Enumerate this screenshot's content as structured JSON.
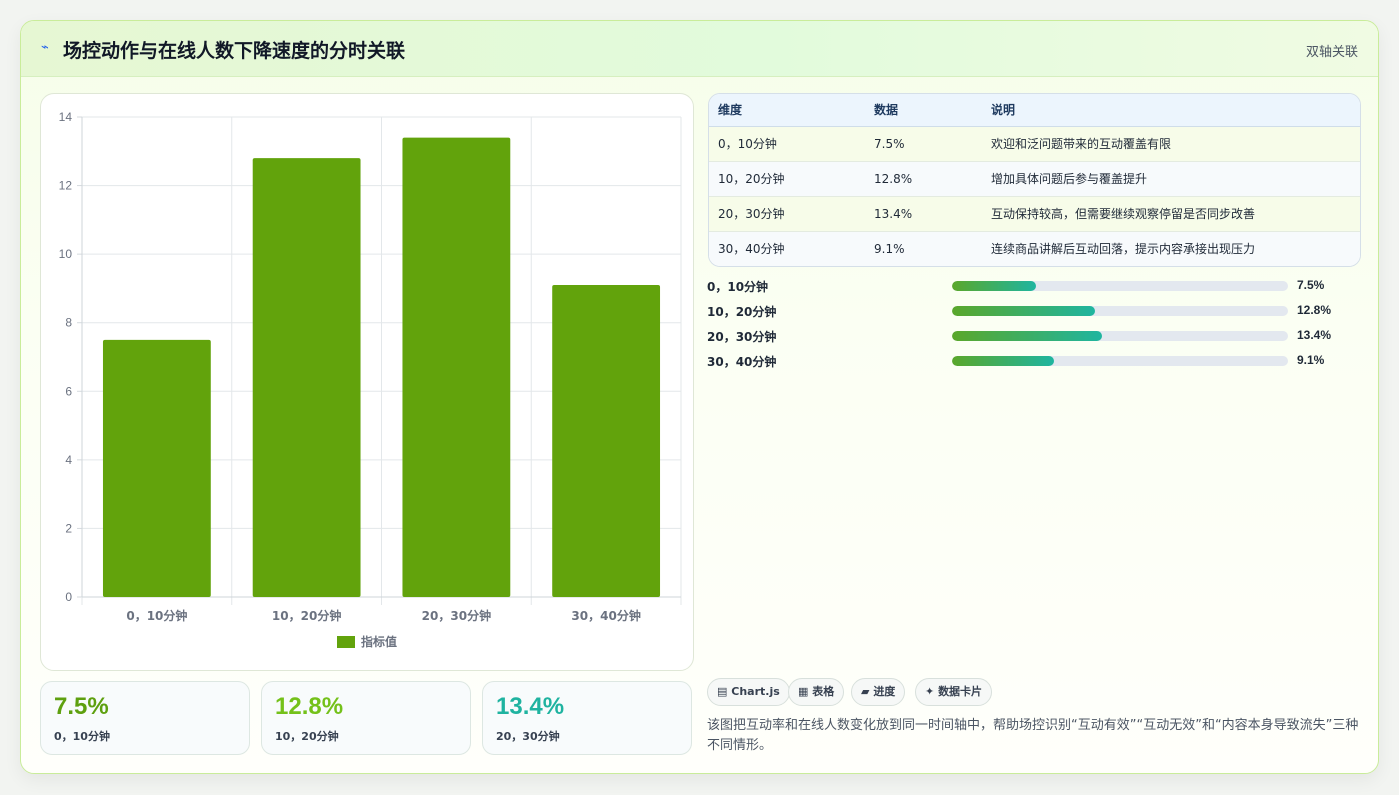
{
  "header": {
    "icon": "chart-spark-icon",
    "title": "场控动作与在线人数下降速度的分时关联",
    "tag": "双轴关联"
  },
  "colors": {
    "bar": "#62a30c",
    "stat1": "#5ea00f",
    "stat2": "#74c11a",
    "stat3": "#1fb3a0",
    "accent": "#1fb5a0"
  },
  "chart_data": {
    "type": "bar",
    "categories": [
      "0，10分钟",
      "10，20分钟",
      "20，30分钟",
      "30，40分钟"
    ],
    "series": [
      {
        "name": "指标值",
        "values": [
          7.5,
          12.8,
          13.4,
          9.1
        ]
      }
    ],
    "ylim": [
      0,
      14
    ],
    "yticks": [
      "0",
      "2",
      "4",
      "6",
      "8",
      "10",
      "12",
      "14"
    ],
    "grid": true,
    "legend": "bottom"
  },
  "stats": [
    {
      "value": "7.5%",
      "label": "0，10分钟"
    },
    {
      "value": "12.8%",
      "label": "10，20分钟"
    },
    {
      "value": "13.4%",
      "label": "20，30分钟"
    }
  ],
  "table": {
    "headers": [
      "维度",
      "数据",
      "说明"
    ],
    "rows": [
      [
        "0，10分钟",
        "7.5%",
        "欢迎和泛问题带来的互动覆盖有限"
      ],
      [
        "10，20分钟",
        "12.8%",
        "增加具体问题后参与覆盖提升"
      ],
      [
        "20，30分钟",
        "13.4%",
        "互动保持较高，但需要继续观察停留是否同步改善"
      ],
      [
        "30，40分钟",
        "9.1%",
        "连续商品讲解后互动回落，提示内容承接出现压力"
      ]
    ]
  },
  "progress": {
    "max_pct": 13.4,
    "items": [
      {
        "label": "0，10分钟",
        "value": "7.5%",
        "pct": 7.5
      },
      {
        "label": "10，20分钟",
        "value": "12.8%",
        "pct": 12.8
      },
      {
        "label": "20，30分钟",
        "value": "13.4%",
        "pct": 13.4
      },
      {
        "label": "30，40分钟",
        "value": "9.1%",
        "pct": 9.1
      }
    ]
  },
  "chips": [
    {
      "icon": "▤",
      "label": "Chart.js"
    },
    {
      "icon": "▦",
      "label": "表格"
    },
    {
      "icon": "▰",
      "label": "进度"
    },
    {
      "icon": "✦",
      "label": "数据卡片"
    }
  ],
  "note": "该图把互动率和在线人数变化放到同一时间轴中，帮助场控识别“互动有效”“互动无效”和“内容本身导致流失”三种不同情形。"
}
